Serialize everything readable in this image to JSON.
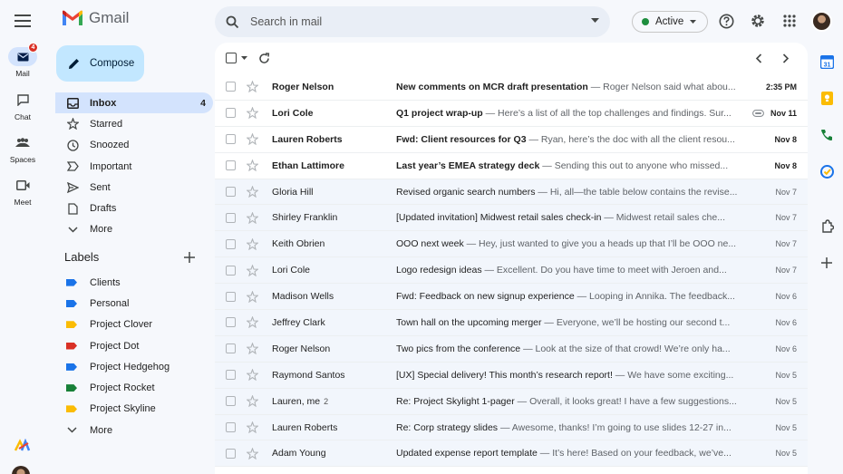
{
  "app": {
    "name": "Gmail",
    "colors": {
      "accent": "#0b57d0",
      "selected": "#d3e3fd",
      "compose": "#c2e7ff",
      "badge": "#d93025",
      "status_green": "#1e8e3e"
    }
  },
  "header": {
    "search_placeholder": "Search in mail",
    "status_label": "Active",
    "icons": [
      "menu-icon",
      "search-icon",
      "help-icon",
      "settings-icon",
      "apps-grid-icon"
    ]
  },
  "rail": {
    "items": [
      {
        "label": "Mail",
        "icon": "mail-icon",
        "badge": "4",
        "active": true
      },
      {
        "label": "Chat",
        "icon": "chat-icon"
      },
      {
        "label": "Spaces",
        "icon": "spaces-icon"
      },
      {
        "label": "Meet",
        "icon": "meet-icon"
      }
    ]
  },
  "compose_label": "Compose",
  "folders": [
    {
      "label": "Inbox",
      "icon": "inbox-icon",
      "count": "4",
      "active": true
    },
    {
      "label": "Starred",
      "icon": "star-icon"
    },
    {
      "label": "Snoozed",
      "icon": "clock-icon"
    },
    {
      "label": "Important",
      "icon": "important-icon"
    },
    {
      "label": "Sent",
      "icon": "send-icon"
    },
    {
      "label": "Drafts",
      "icon": "draft-icon"
    },
    {
      "label": "More",
      "icon": "chevron-down-icon"
    }
  ],
  "labels": {
    "title": "Labels",
    "items": [
      {
        "label": "Clients",
        "color": "#1a73e8"
      },
      {
        "label": "Personal",
        "color": "#1a73e8"
      },
      {
        "label": "Project Clover",
        "color": "#fbbc04"
      },
      {
        "label": "Project Dot",
        "color": "#d93025"
      },
      {
        "label": "Project Hedgehog",
        "color": "#1a73e8"
      },
      {
        "label": "Project Rocket",
        "color": "#188038"
      },
      {
        "label": "Project Skyline",
        "color": "#fbbc04"
      }
    ],
    "more_label": "More"
  },
  "emails": [
    {
      "sender": "Roger Nelson",
      "count": "",
      "subject": "New comments on MCR draft presentation",
      "snippet": " — Roger Nelson said what abou...",
      "date": "2:35 PM",
      "unread": true,
      "attachment": false
    },
    {
      "sender": "Lori Cole",
      "count": "",
      "subject": "Q1 project wrap-up",
      "snippet": " — Here’s a list of all the top challenges and findings. Sur...",
      "date": "Nov 11",
      "unread": true,
      "attachment": true
    },
    {
      "sender": "Lauren Roberts",
      "count": "",
      "subject": "Fwd: Client resources for Q3",
      "snippet": " — Ryan, here’s the doc with all the client resou...",
      "date": "Nov 8",
      "unread": true,
      "attachment": false
    },
    {
      "sender": "Ethan Lattimore",
      "count": "",
      "subject": "Last year’s EMEA strategy deck",
      "snippet": " — Sending this out to anyone who missed...",
      "date": "Nov 8",
      "unread": true,
      "attachment": false
    },
    {
      "sender": "Gloria Hill",
      "count": "",
      "subject": "Revised organic search numbers",
      "snippet": " — Hi, all—the table below contains the revise...",
      "date": "Nov 7",
      "unread": false,
      "attachment": false
    },
    {
      "sender": "Shirley Franklin",
      "count": "",
      "subject": "[Updated invitation] Midwest retail sales check-in",
      "snippet": " — Midwest retail sales che...",
      "date": "Nov 7",
      "unread": false,
      "attachment": false
    },
    {
      "sender": "Keith Obrien",
      "count": "",
      "subject": "OOO next week",
      "snippet": " — Hey, just wanted to give you a heads up that I’ll be OOO ne...",
      "date": "Nov 7",
      "unread": false,
      "attachment": false
    },
    {
      "sender": "Lori Cole",
      "count": "",
      "subject": "Logo redesign ideas",
      "snippet": " — Excellent. Do you have time to meet with Jeroen and...",
      "date": "Nov 7",
      "unread": false,
      "attachment": false
    },
    {
      "sender": "Madison Wells",
      "count": "",
      "subject": "Fwd: Feedback on new signup experience",
      "snippet": " — Looping in Annika. The feedback...",
      "date": "Nov 6",
      "unread": false,
      "attachment": false
    },
    {
      "sender": "Jeffrey Clark",
      "count": "",
      "subject": "Town hall on the upcoming merger",
      "snippet": " — Everyone, we’ll be hosting our second t...",
      "date": "Nov 6",
      "unread": false,
      "attachment": false
    },
    {
      "sender": "Roger Nelson",
      "count": "",
      "subject": "Two pics from the conference",
      "snippet": " — Look at the size of that crowd! We’re only ha...",
      "date": "Nov 6",
      "unread": false,
      "attachment": false
    },
    {
      "sender": "Raymond Santos",
      "count": "",
      "subject": "[UX] Special delivery! This month’s research report!",
      "snippet": " — We have some exciting...",
      "date": "Nov 5",
      "unread": false,
      "attachment": false
    },
    {
      "sender": "Lauren, me",
      "count": "2",
      "subject": "Re: Project Skylight 1-pager",
      "snippet": " — Overall, it looks great! I have a few suggestions...",
      "date": "Nov 5",
      "unread": false,
      "attachment": false
    },
    {
      "sender": "Lauren Roberts",
      "count": "",
      "subject": "Re: Corp strategy slides",
      "snippet": " — Awesome, thanks! I’m going to use slides 12-27 in...",
      "date": "Nov 5",
      "unread": false,
      "attachment": false
    },
    {
      "sender": "Adam Young",
      "count": "",
      "subject": "Updated expense report template",
      "snippet": " — It’s here! Based on your feedback, we’ve...",
      "date": "Nov 5",
      "unread": false,
      "attachment": false
    }
  ],
  "side_apps": [
    {
      "name": "calendar-icon",
      "color": "#1a73e8"
    },
    {
      "name": "keep-icon",
      "color": "#fbbc04"
    },
    {
      "name": "contacts-icon",
      "color": "#188038"
    },
    {
      "name": "tasks-icon",
      "color": "#1a73e8"
    },
    {
      "name": "addons-icon",
      "color": "#444746"
    },
    {
      "name": "plus-icon",
      "color": "#444746"
    }
  ]
}
